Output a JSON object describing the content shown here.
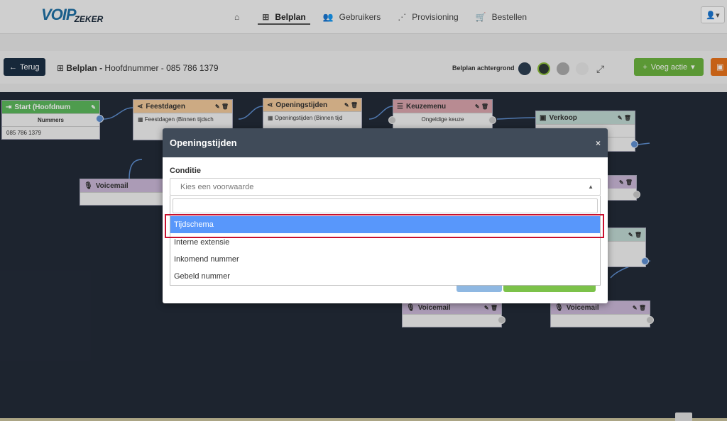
{
  "logo": {
    "main": "VOIP",
    "sub": "ZEKER"
  },
  "nav": {
    "home_icon": "home-icon",
    "items": [
      {
        "label": "Belplan",
        "icon": "sitemap-icon",
        "active": true
      },
      {
        "label": "Gebruikers",
        "icon": "users-icon"
      },
      {
        "label": "Provisioning",
        "icon": "network-icon"
      },
      {
        "label": "Bestellen",
        "icon": "cart-icon"
      }
    ],
    "user_icon": "user-icon"
  },
  "toolbar": {
    "back_label": "Terug",
    "crumb_title": "Belplan -",
    "crumb_sub": "Hoofdnummer - 085 786 1379",
    "bg_label": "Belplan achtergrond",
    "swatches": [
      "#2c3e50",
      "#2e3a34",
      "#aaaaaa",
      "#e6e6e6"
    ],
    "add_label": "Voeg actie",
    "colors": {
      "back": "#1c2f45",
      "add": "#6cb33f",
      "save": "#e8731a"
    }
  },
  "nodes": {
    "start": {
      "title": "Start (Hoofdnum",
      "row1": "Nummers",
      "row2": "085 786 1379"
    },
    "feestdagen": {
      "title": "Feestdagen",
      "row1": "Feestdagen (Binnen tijdsch"
    },
    "openingstijden": {
      "title": "Openingstijden",
      "row1": "Openingstijden (Binnen tijd"
    },
    "keuzemenu": {
      "title": "Keuzemenu",
      "row1": "Ongeldige keuze"
    },
    "verkoop": {
      "title": "Verkoop"
    },
    "voicemail_left": {
      "title": "Voicemail"
    },
    "voicemail_mid": {
      "title": "Voicemail"
    },
    "voicemail_right": {
      "title": "Voicemail"
    }
  },
  "modal": {
    "title": "Openingstijden",
    "close": "×",
    "condition_label": "Conditie",
    "select_placeholder": "Kies een voorwaarde",
    "options": [
      "Tijdschema",
      "Interne extensie",
      "Inkomend nummer",
      "Gebeld nummer"
    ],
    "highlighted_index": 0
  }
}
